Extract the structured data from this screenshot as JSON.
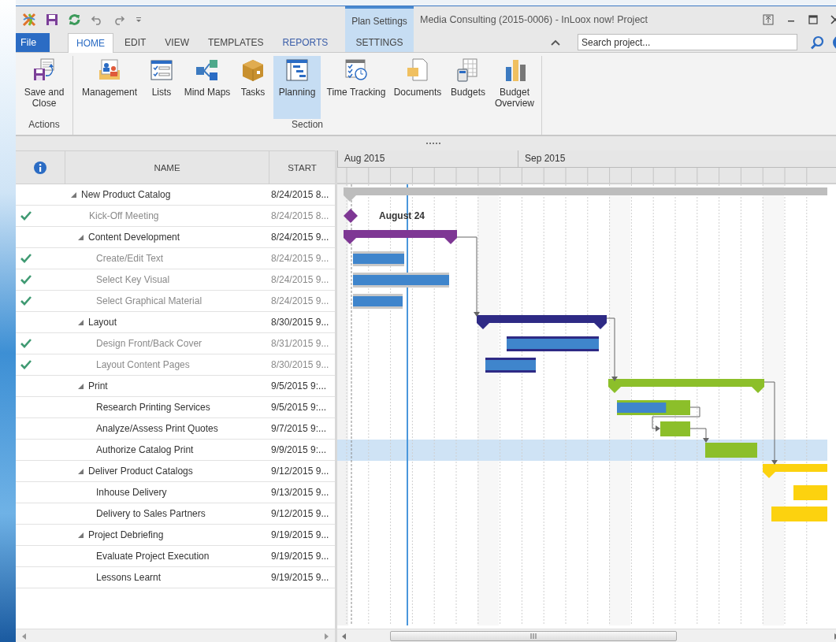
{
  "window": {
    "title": "Media Consulting (2015-0006) - InLoox now! Project",
    "contextual_group": "Plan Settings"
  },
  "ribbon": {
    "file_tab": "File",
    "tabs": [
      {
        "label": "HOME",
        "selected": true
      },
      {
        "label": "EDIT",
        "selected": false
      },
      {
        "label": "VIEW",
        "selected": false
      },
      {
        "label": "TEMPLATES",
        "selected": false
      },
      {
        "label": "REPORTS",
        "selected": false
      },
      {
        "label": "SETTINGS",
        "selected": false,
        "kind": "contextual"
      }
    ],
    "search": {
      "placeholder": "Search project..."
    },
    "groups": [
      {
        "label": "Actions",
        "buttons": [
          {
            "label": "Save and Close",
            "selected": false
          }
        ]
      },
      {
        "label": "Section",
        "buttons": [
          {
            "label": "Management",
            "selected": false
          },
          {
            "label": "Lists",
            "selected": false
          },
          {
            "label": "Mind Maps",
            "selected": false
          },
          {
            "label": "Tasks",
            "selected": false
          },
          {
            "label": "Planning",
            "selected": true
          },
          {
            "label": "Time Tracking",
            "selected": false
          },
          {
            "label": "Documents",
            "selected": false
          },
          {
            "label": "Budgets",
            "selected": false
          },
          {
            "label": "Budget Overview",
            "selected": false
          }
        ]
      }
    ]
  },
  "grid": {
    "columns": [
      "NAME",
      "START"
    ],
    "rows": [
      {
        "name": "New Product Catalog",
        "start": "8/24/2015 8...",
        "kind": "summary",
        "expanded": true,
        "checked": false,
        "selected": false,
        "color": "#bdbdbd",
        "children": [
          {
            "name": "Kick-Off Meeting",
            "start": "8/24/2015 8...",
            "kind": "milestone",
            "checked": true,
            "selected": false,
            "color": "#7e3794",
            "bar_label": "August 24"
          },
          {
            "name": "Content Development",
            "start": "8/24/2015 9...",
            "kind": "summary",
            "expanded": true,
            "checked": false,
            "selected": false,
            "color": "#7e3794",
            "children": [
              {
                "name": "Create/Edit Text",
                "start": "8/24/2015 9...",
                "kind": "task",
                "checked": true,
                "selected": false,
                "color": "#c8c8c8",
                "level": 1
              },
              {
                "name": "Select Key Visual",
                "start": "8/24/2015 9...",
                "kind": "task",
                "checked": true,
                "selected": false,
                "color": "#c8c8c8",
                "level": 1
              },
              {
                "name": "Select Graphical Material",
                "start": "8/24/2015 9...",
                "kind": "task",
                "checked": true,
                "selected": false,
                "color": "#c8c8c8",
                "level": 1
              }
            ]
          },
          {
            "name": "Layout",
            "start": "8/30/2015 9...",
            "kind": "summary",
            "expanded": true,
            "checked": false,
            "selected": false,
            "color": "#2e2a85",
            "children": [
              {
                "name": "Design Front/Back Cover",
                "start": "8/31/2015 9...",
                "kind": "task",
                "checked": true,
                "selected": false,
                "color": "#2e2a85",
                "level": 1
              },
              {
                "name": "Layout Content Pages",
                "start": "8/30/2015 9...",
                "kind": "task",
                "checked": true,
                "selected": false,
                "color": "#2e2a85",
                "level": 1
              }
            ]
          },
          {
            "name": "Print",
            "start": "9/5/2015 9:...",
            "kind": "summary",
            "expanded": true,
            "checked": false,
            "selected": false,
            "color": "#8cbf2a",
            "children": [
              {
                "name": "Research Printing Services",
                "start": "9/5/2015 9:...",
                "kind": "task",
                "checked": false,
                "selected": false,
                "color": "#8cbf2a",
                "level": 0.67
              },
              {
                "name": "Analyze/Assess Print Quotes",
                "start": "9/7/2015 9:...",
                "kind": "task",
                "checked": false,
                "selected": false,
                "color": "#8cbf2a"
              },
              {
                "name": "Authorize Catalog Print",
                "start": "9/9/2015 9:...",
                "kind": "task",
                "checked": false,
                "selected": true,
                "color": "#8cbf2a"
              }
            ]
          },
          {
            "name": "Deliver Product Catalogs",
            "start": "9/12/2015 9...",
            "kind": "summary",
            "expanded": true,
            "checked": false,
            "selected": false,
            "color": "#fcd20f",
            "children": [
              {
                "name": "Inhouse Delivery",
                "start": "9/13/2015 9...",
                "kind": "task",
                "checked": false,
                "selected": false,
                "color": "#fcd20f"
              },
              {
                "name": "Delivery to Sales Partners",
                "start": "9/12/2015 9...",
                "kind": "task",
                "checked": false,
                "selected": false,
                "color": "#fcd20f"
              }
            ]
          },
          {
            "name": "Project Debriefing",
            "start": "9/19/2015 9...",
            "kind": "summary",
            "expanded": true,
            "checked": false,
            "selected": false,
            "children": [
              {
                "name": "Evaluate Project Execution",
                "start": "9/19/2015 9...",
                "kind": "task",
                "checked": false,
                "selected": false
              },
              {
                "name": "Lessons Learnt",
                "start": "9/19/2015 9...",
                "kind": "task",
                "checked": false,
                "selected": false
              }
            ]
          }
        ]
      }
    ]
  },
  "gantt": {
    "months": [
      "Aug 2015",
      "Sep 2015"
    ]
  }
}
